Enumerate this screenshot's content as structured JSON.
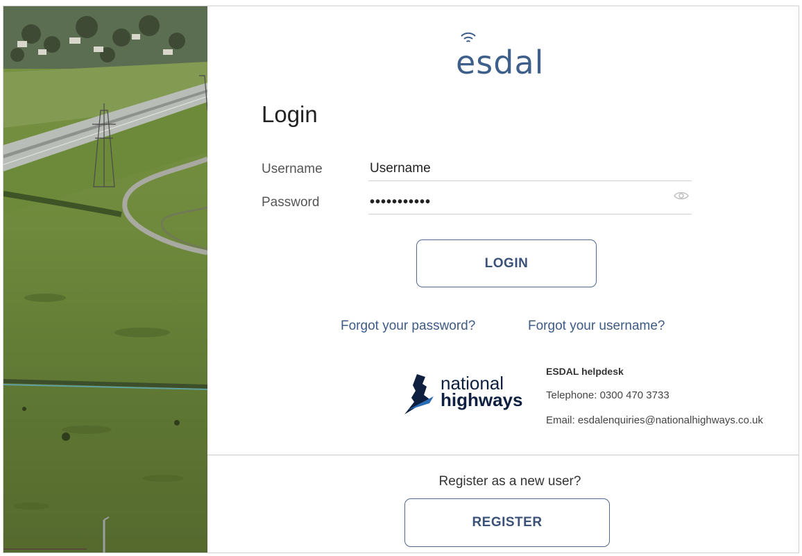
{
  "brand": {
    "name": "esdal"
  },
  "login": {
    "title": "Login",
    "username_label": "Username",
    "username_value": "Username",
    "password_label": "Password",
    "password_masked": "•••••••••••",
    "login_button": "LOGIN",
    "forgot_password": "Forgot your password?",
    "forgot_username": "Forgot your username?"
  },
  "helpdesk": {
    "logo_line1": "national",
    "logo_line2": "highways",
    "title": "ESDAL helpdesk",
    "telephone": "Telephone: 0300 470 3733",
    "email": "Email: esdalenquiries@nationalhighways.co.uk"
  },
  "register": {
    "prompt": "Register as a new user?",
    "button": "REGISTER"
  },
  "colors": {
    "accent": "#3d5f8a",
    "button_border": "#4f678f",
    "nh_blue": "#2a6db5",
    "nh_navy": "#0e1f3f"
  },
  "icons": [
    "wifi-icon",
    "eye-icon",
    "national-highways-logo-icon"
  ]
}
